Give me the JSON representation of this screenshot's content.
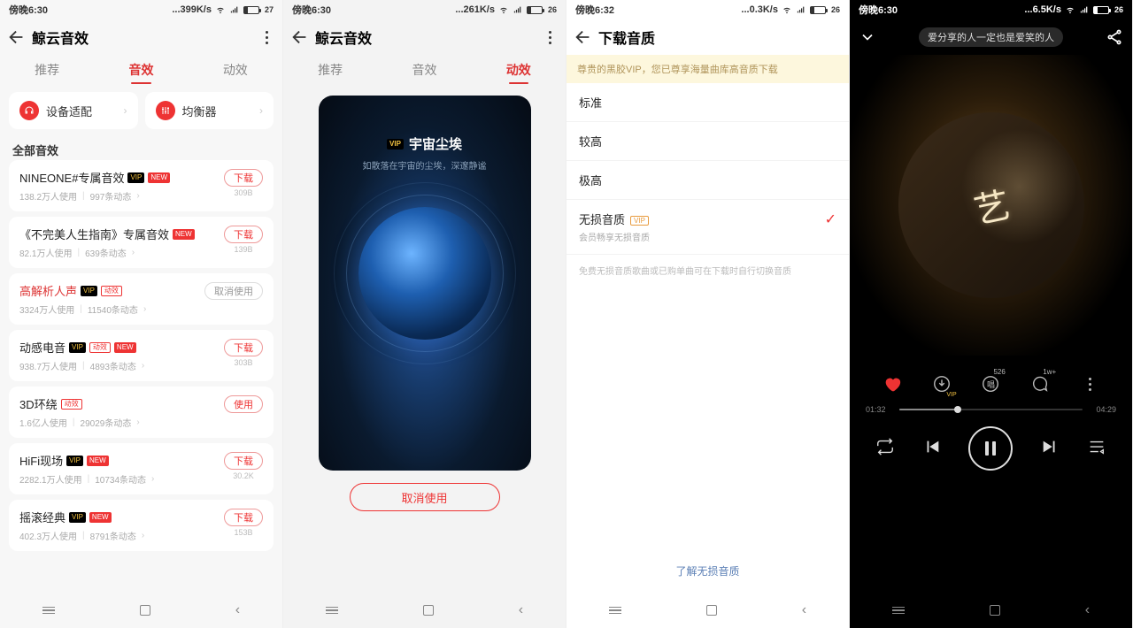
{
  "status": [
    {
      "time": "傍晚6:30",
      "speed": "...399K/s",
      "batt": "27"
    },
    {
      "time": "傍晚6:30",
      "speed": "...261K/s",
      "batt": "26"
    },
    {
      "time": "傍晚6:32",
      "speed": "...0.3K/s",
      "batt": "26"
    },
    {
      "time": "傍晚6:30",
      "speed": "...6.5K/s",
      "batt": "26"
    }
  ],
  "p1": {
    "title": "鲸云音效",
    "tabs": [
      "推荐",
      "音效",
      "动效"
    ],
    "active": 1,
    "chip1": "设备适配",
    "chip2": "均衡器",
    "section": "全部音效",
    "dl": "下载",
    "use": "使用",
    "cancel": "取消使用",
    "items": [
      {
        "name": "NINEONE#专属音效",
        "users": "138.2万人使用",
        "dyn": "997条动态",
        "badges": [
          "vip",
          "new"
        ],
        "btn": "dl",
        "size": "309B"
      },
      {
        "name": "《不完美人生指南》专属音效",
        "users": "82.1万人使用",
        "dyn": "639条动态",
        "badges": [
          "new"
        ],
        "btn": "dl",
        "size": "139B"
      },
      {
        "name": "高解析人声",
        "users": "3324万人使用",
        "dyn": "11540条动态",
        "badges": [
          "vip",
          "dx"
        ],
        "btn": "cancel",
        "hilite": true
      },
      {
        "name": "动感电音",
        "users": "938.7万人使用",
        "dyn": "4893条动态",
        "badges": [
          "vip",
          "dx",
          "new"
        ],
        "btn": "dl",
        "size": "303B"
      },
      {
        "name": "3D环绕",
        "users": "1.6亿人使用",
        "dyn": "29029条动态",
        "badges": [
          "dx"
        ],
        "btn": "use"
      },
      {
        "name": "HiFi现场",
        "users": "2282.1万人使用",
        "dyn": "10734条动态",
        "badges": [
          "vip",
          "new"
        ],
        "btn": "dl",
        "size": "30.2K"
      },
      {
        "name": "摇滚经典",
        "users": "402.3万人使用",
        "dyn": "8791条动态",
        "badges": [
          "vip",
          "new"
        ],
        "btn": "dl",
        "size": "153B"
      }
    ]
  },
  "p2": {
    "title": "鲸云音效",
    "tabs": [
      "推荐",
      "音效",
      "动效"
    ],
    "active": 2,
    "eff_title": "宇宙尘埃",
    "eff_sub": "如散落在宇宙的尘埃，深邃静谧",
    "btn": "取消使用"
  },
  "p3": {
    "title": "下载音质",
    "banner": "尊贵的黑胶VIP，您已尊享海量曲库高音质下载",
    "opts": [
      "标准",
      "较高",
      "极高"
    ],
    "lossless": "无损音质",
    "lossless_sub": "会员畅享无损音质",
    "vip": "VIP",
    "hint": "免费无损音质歌曲或已购单曲可在下载时自行切换音质",
    "link": "了解无损音质"
  },
  "p4": {
    "pill": "爱分享的人一定也是爱笑的人",
    "t1": "01:32",
    "t2": "04:29",
    "sup1": "526",
    "sup2": "1w+"
  },
  "badge_text": {
    "vip": "VIP",
    "new": "NEW",
    "dx": "动效"
  }
}
